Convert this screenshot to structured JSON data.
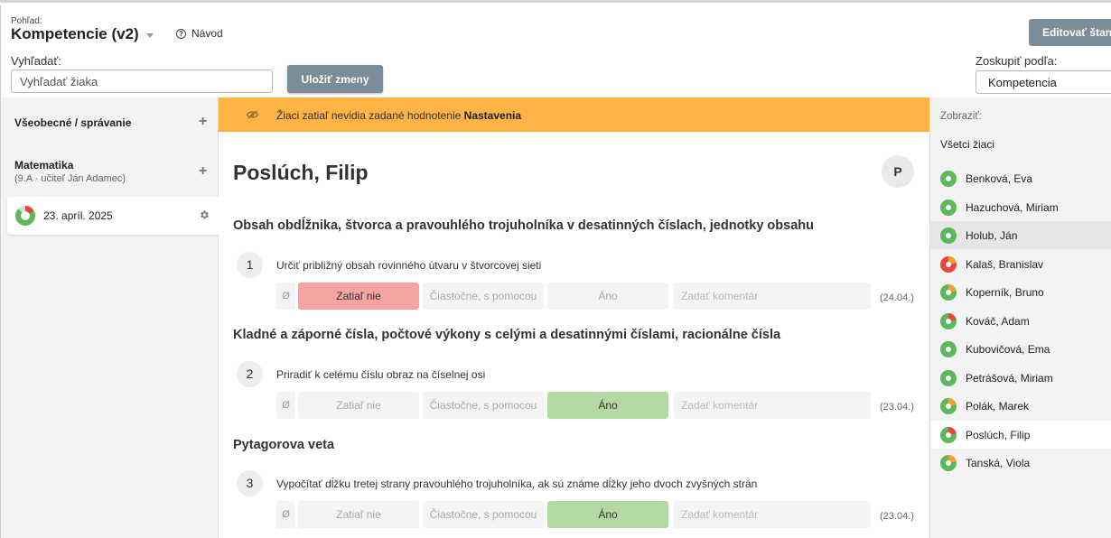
{
  "header": {
    "view_label": "Pohľad:",
    "view_title": "Kompetencie (v2)",
    "guide_label": "Návod",
    "edit_button": "Editovať štandardy",
    "search_label": "Vyhľadať:",
    "search_placeholder": "Vyhľadať žiaka",
    "save_button": "Uložiť zmeny",
    "group_label": "Zoskupiť podľa:",
    "group_value": "Kompetencia"
  },
  "sidebar": {
    "categories": [
      {
        "title": "Všeobecné / správanie",
        "subtitle": ""
      },
      {
        "title": "Matematika",
        "subtitle": "(9.A · učiteľ Ján Adamec)"
      }
    ],
    "date_item": "23. apríl. 2025"
  },
  "banner": {
    "text": "Žiaci zatiaľ nevidia zadané hodnotenie",
    "link": "Nastavenia"
  },
  "student": {
    "name": "Poslúch, Filip",
    "initial": "P"
  },
  "options": {
    "null": "Ø",
    "no": "Zatiaľ nie",
    "partial": "Čiastočne, s pomocou",
    "yes": "Áno",
    "comment_placeholder": "Zadať komentár"
  },
  "sections": [
    {
      "title": "Obsah obdĺžnika, štvorca a pravouhlého trojuholníka v desatinných číslach, jednotky obsahu",
      "question": {
        "number": "1",
        "text": "Určiť približný obsah rovinného útvaru v štvorcovej sieti",
        "selected": "no",
        "date": "(24.04.)"
      }
    },
    {
      "title": "Kladné a záporné čísla, počtové výkony s celými a desatinnými číslami, racionálne čísla",
      "question": {
        "number": "2",
        "text": "Priradiť k celému číslu obraz na číselnej osi",
        "selected": "yes",
        "date": "(23.04.)"
      }
    },
    {
      "title": "Pytagorova veta",
      "question": {
        "number": "3",
        "text": "Vypočítať dĺžku tretej strany pravouhlého trojuholníka, ak sú známe dĺžky jeho dvoch zvyšných strán",
        "selected": "yes",
        "date": "(23.04.)"
      }
    }
  ],
  "right_panel": {
    "show_label": "Zobraziť:",
    "all_label": "Všetci žiaci",
    "students": [
      {
        "name": "Benková, Eva",
        "status": "green"
      },
      {
        "name": "Hazuchová, Miriam",
        "status": "green"
      },
      {
        "name": "Holub, Ján",
        "status": "green"
      },
      {
        "name": "Kalaš, Branislav",
        "status": "red-orange"
      },
      {
        "name": "Koperník, Bruno",
        "status": "green-orange"
      },
      {
        "name": "Kováč, Adam",
        "status": "green-red"
      },
      {
        "name": "Kubovičová, Ema",
        "status": "green"
      },
      {
        "name": "Petrášová, Miriam",
        "status": "green"
      },
      {
        "name": "Polák, Marek",
        "status": "green-orange"
      },
      {
        "name": "Poslúch, Filip",
        "status": "green-red"
      },
      {
        "name": "Tanská, Viola",
        "status": "green-orange"
      }
    ]
  },
  "colors": {
    "green": "#5cb85c",
    "red": "#e8453c",
    "orange": "#f0a030",
    "banner": "#ffb347",
    "button": "#7b8d99",
    "selected_no": "#f5a3a3",
    "selected_yes": "#b5d9a2"
  }
}
